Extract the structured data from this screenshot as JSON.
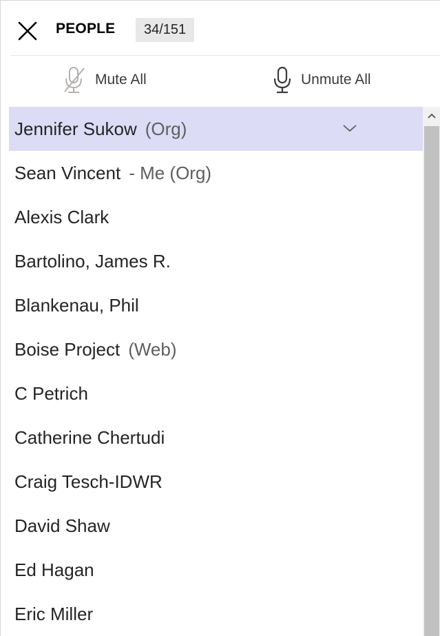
{
  "header": {
    "title": "PEOPLE",
    "count": "34/151"
  },
  "toolbar": {
    "mute_all_label": "Mute All",
    "unmute_all_label": "Unmute All"
  },
  "participants": [
    {
      "name": "Jennifer Sukow",
      "tag": "(Org)",
      "selected": true
    },
    {
      "name": "Sean Vincent",
      "tag": " - Me (Org)"
    },
    {
      "name": "Alexis Clark",
      "tag": ""
    },
    {
      "name": "Bartolino, James R.",
      "tag": ""
    },
    {
      "name": "Blankenau, Phil",
      "tag": ""
    },
    {
      "name": "Boise Project",
      "tag": "(Web)"
    },
    {
      "name": "C Petrich",
      "tag": ""
    },
    {
      "name": "Catherine Chertudi",
      "tag": ""
    },
    {
      "name": "Craig Tesch-IDWR",
      "tag": ""
    },
    {
      "name": "David Shaw",
      "tag": ""
    },
    {
      "name": "Ed Hagan",
      "tag": ""
    },
    {
      "name": "Eric Miller",
      "tag": ""
    }
  ],
  "colors": {
    "selected_row": "#dcdcf7",
    "badge_bg": "#e8e8e8",
    "scrollbar_thumb": "#c1c1c1"
  }
}
